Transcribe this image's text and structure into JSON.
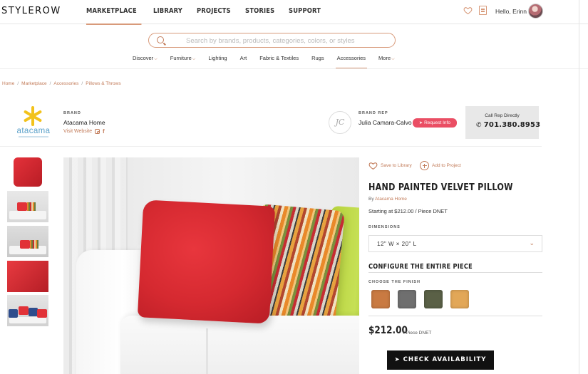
{
  "header": {
    "logo": "STYLEROW",
    "nav": [
      "MARKETPLACE",
      "LIBRARY",
      "PROJECTS",
      "STORIES",
      "SUPPORT"
    ],
    "greeting": "Hello, Erinn"
  },
  "search": {
    "placeholder": "Search by brands, products, categories, colors, or styles",
    "value": ""
  },
  "categories": [
    "Discover",
    "Furniture",
    "Lighting",
    "Art",
    "Fabric & Textiles",
    "Rugs",
    "Accessories",
    "More"
  ],
  "breadcrumb": [
    "Home",
    "Marketplace",
    "Accessories",
    "Pillows & Throws"
  ],
  "brand": {
    "logo_text": "atacama",
    "caption": "BRAND",
    "name": "Atacama Home",
    "visit": "Visit Website"
  },
  "rep": {
    "initials": "JC",
    "caption": "BRAND REP",
    "name": "Julia Camara-Calvo",
    "request_label": "Request Info"
  },
  "call": {
    "label": "Call Rep Directly",
    "number": "701.380.8953"
  },
  "actions": {
    "save": "Save to Library",
    "project": "Add to Project"
  },
  "product": {
    "title": "HAND PAINTED VELVET PILLOW",
    "by_prefix": "By",
    "by_brand": "Atacama Home",
    "starting": "Starting at $212.00 / Piece DNET",
    "dimensions_label": "DIMENSIONS",
    "dimensions_value": "12\" W × 20\" L",
    "config_title": "CONFIGURE THE ENTIRE PIECE",
    "finish_label": "CHOOSE THE FINISH",
    "price": "$212.00",
    "price_unit": "/ Piece DNET",
    "check_label": "CHECK AVAILABILITY"
  },
  "finishes": [
    {
      "name": "rust",
      "color": "#c97a42"
    },
    {
      "name": "grey",
      "color": "#6f6f6f"
    },
    {
      "name": "olive",
      "color": "#5a6046"
    },
    {
      "name": "mustard",
      "color": "#e2a757"
    }
  ],
  "colors": {
    "accent": "#c27b59",
    "request": "#ea4e64",
    "brand_star": "#f2c21b",
    "brand_text": "#5aa0c9"
  }
}
